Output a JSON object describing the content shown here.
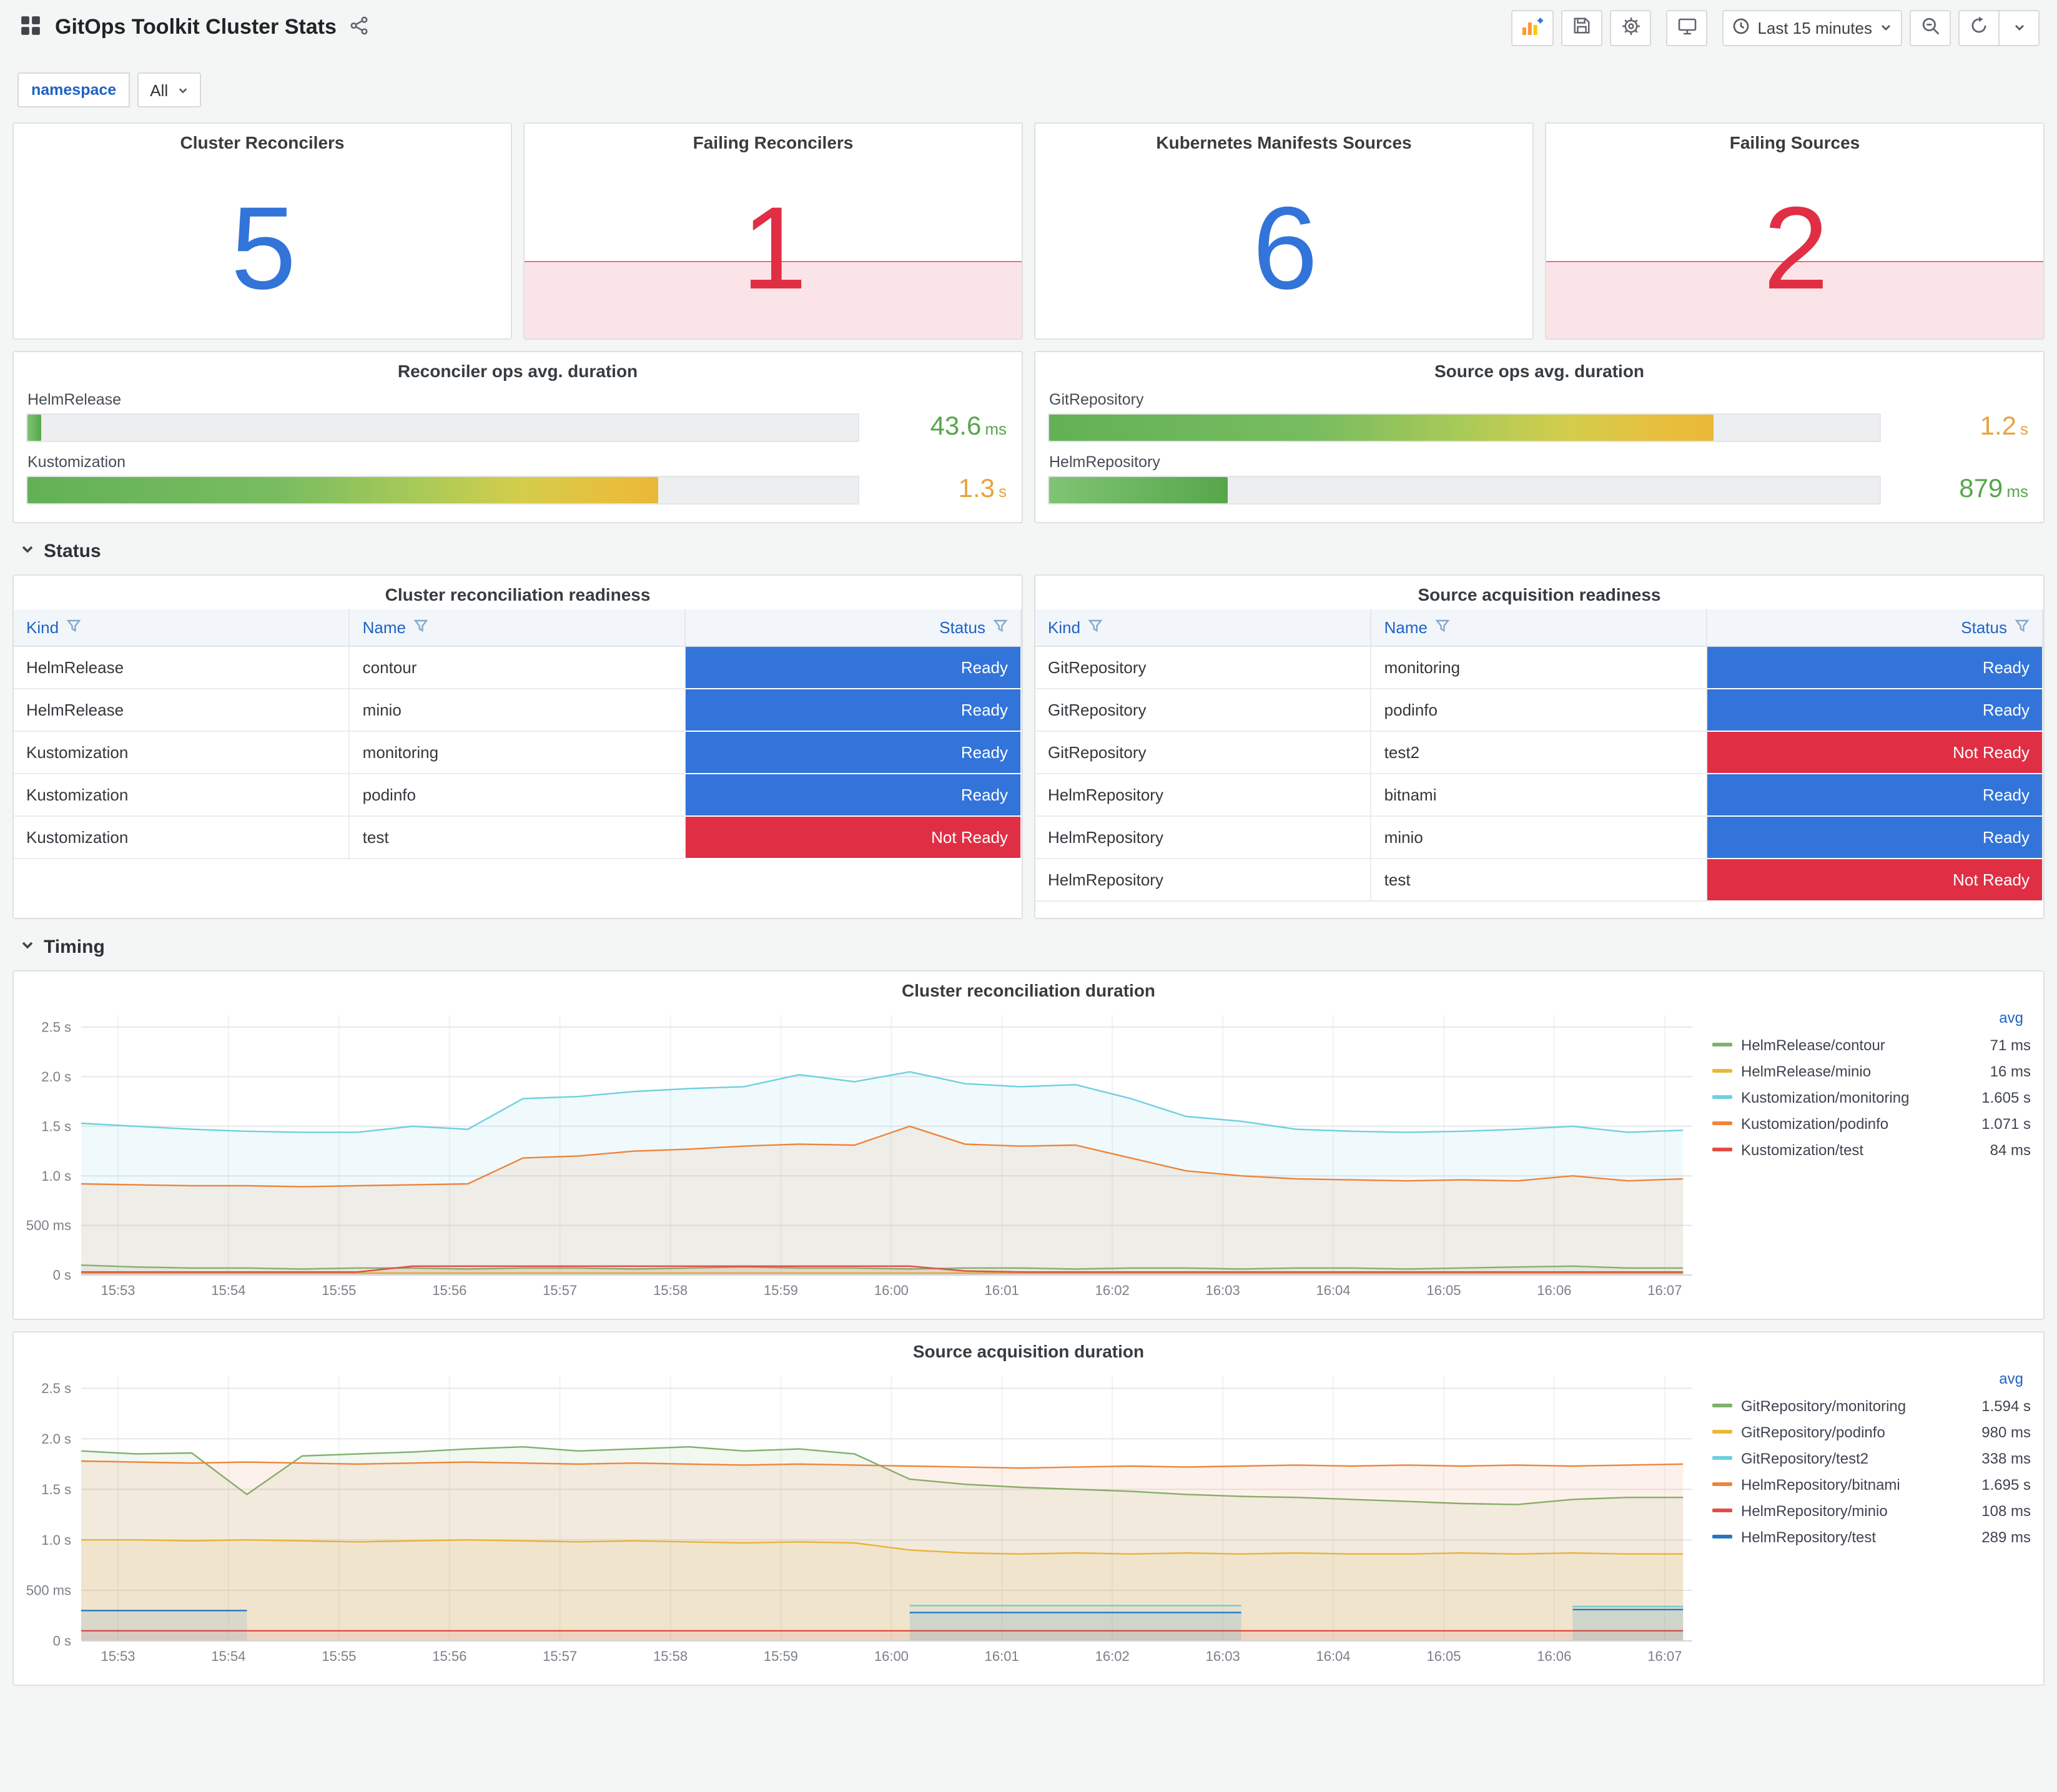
{
  "header": {
    "title": "GitOps Toolkit Cluster Stats",
    "time_range": "Last 15 minutes"
  },
  "icons": {
    "apps": "grid-icon",
    "share": "share-icon",
    "add_panel": "add-panel-icon",
    "save": "save-icon",
    "settings": "gear-icon",
    "tv": "monitor-icon",
    "clock": "clock-icon",
    "caret": "chevron-down-icon",
    "zoom_out": "zoom-out-icon",
    "refresh": "refresh-icon",
    "filter": "filter-funnel-icon"
  },
  "variables": {
    "label": "namespace",
    "value": "All"
  },
  "sections": {
    "status": "Status",
    "timing": "Timing"
  },
  "stats": [
    {
      "title": "Cluster Reconcilers",
      "value": "5",
      "color": "#3274d9",
      "fill": false
    },
    {
      "title": "Failing Reconcilers",
      "value": "1",
      "color": "#e02f44",
      "fill": true,
      "fill_bg": "rgba(224,47,68,0.13)",
      "fill_line": "rgba(224,47,68,0.65)"
    },
    {
      "title": "Kubernetes Manifests Sources",
      "value": "6",
      "color": "#3274d9",
      "fill": false
    },
    {
      "title": "Failing Sources",
      "value": "2",
      "color": "#e02f44",
      "fill": true,
      "fill_bg": "rgba(224,47,68,0.13)",
      "fill_line": "rgba(224,47,68,0.65)"
    }
  ],
  "gauges": [
    {
      "title": "Reconciler ops avg. duration",
      "rows": [
        {
          "label": "HelmRelease",
          "value": "43.6",
          "unit": "ms",
          "percent": 1.6,
          "value_color": "#56a64b",
          "gradient": "green"
        },
        {
          "label": "Kustomization",
          "value": "1.3",
          "unit": "s",
          "percent": 76,
          "value_color": "#e8a33c",
          "gradient": "green-yellow"
        }
      ]
    },
    {
      "title": "Source ops avg. duration",
      "rows": [
        {
          "label": "GitRepository",
          "value": "1.2",
          "unit": "s",
          "percent": 80,
          "value_color": "#e8a33c",
          "gradient": "green-yellow"
        },
        {
          "label": "HelmRepository",
          "value": "879",
          "unit": "ms",
          "percent": 21.5,
          "value_color": "#56a64b",
          "gradient": "green"
        }
      ]
    }
  ],
  "tables": [
    {
      "title": "Cluster reconciliation readiness",
      "columns": [
        "Kind",
        "Name",
        "Status"
      ],
      "rows": [
        {
          "kind": "HelmRelease",
          "name": "contour",
          "status": "Ready"
        },
        {
          "kind": "HelmRelease",
          "name": "minio",
          "status": "Ready"
        },
        {
          "kind": "Kustomization",
          "name": "monitoring",
          "status": "Ready"
        },
        {
          "kind": "Kustomization",
          "name": "podinfo",
          "status": "Ready"
        },
        {
          "kind": "Kustomization",
          "name": "test",
          "status": "Not Ready"
        }
      ]
    },
    {
      "title": "Source acquisition readiness",
      "columns": [
        "Kind",
        "Name",
        "Status"
      ],
      "rows": [
        {
          "kind": "GitRepository",
          "name": "monitoring",
          "status": "Ready"
        },
        {
          "kind": "GitRepository",
          "name": "podinfo",
          "status": "Ready"
        },
        {
          "kind": "GitRepository",
          "name": "test2",
          "status": "Not Ready"
        },
        {
          "kind": "HelmRepository",
          "name": "bitnami",
          "status": "Ready"
        },
        {
          "kind": "HelmRepository",
          "name": "minio",
          "status": "Ready"
        },
        {
          "kind": "HelmRepository",
          "name": "test",
          "status": "Not Ready"
        }
      ]
    }
  ],
  "status_colors": {
    "Ready": "#3274d9",
    "Not Ready": "#e02f44"
  },
  "chart_data": [
    {
      "type": "line",
      "title": "Cluster reconciliation duration",
      "xlabel": "",
      "ylabel": "",
      "grid": true,
      "legend_position": "right",
      "legend_header": "avg",
      "ylim": [
        0,
        2.62
      ],
      "yticks": [
        {
          "v": 0,
          "label": "0 s"
        },
        {
          "v": 0.5,
          "label": "500 ms"
        },
        {
          "v": 1,
          "label": "1.0 s"
        },
        {
          "v": 1.5,
          "label": "1.5 s"
        },
        {
          "v": 2,
          "label": "2.0 s"
        },
        {
          "v": 2.5,
          "label": "2.5 s"
        }
      ],
      "x0": 0,
      "x_step": 30,
      "x_range": [
        0,
        875
      ],
      "xticks": {
        "start": 20,
        "step": 60,
        "labels": [
          "15:53",
          "15:54",
          "15:55",
          "15:56",
          "15:57",
          "15:58",
          "15:59",
          "16:00",
          "16:01",
          "16:02",
          "16:03",
          "16:04",
          "16:05",
          "16:06",
          "16:07"
        ]
      },
      "series": [
        {
          "name": "HelmRelease/contour",
          "color": "#7EB26D",
          "avg": "71 ms",
          "values": [
            0.1,
            0.08,
            0.07,
            0.07,
            0.06,
            0.07,
            0.07,
            0.06,
            0.07,
            0.07,
            0.06,
            0.07,
            0.08,
            0.07,
            0.07,
            0.06,
            0.07,
            0.07,
            0.06,
            0.07,
            0.07,
            0.06,
            0.07,
            0.07,
            0.06,
            0.07,
            0.08,
            0.09,
            0.07,
            0.07
          ]
        },
        {
          "name": "HelmRelease/minio",
          "color": "#EAB839",
          "avg": "16 ms",
          "values": [
            0.02,
            0.02,
            0.02,
            0.02,
            0.02,
            0.02,
            0.02,
            0.02,
            0.02,
            0.02,
            0.02,
            0.02,
            0.02,
            0.02,
            0.02,
            0.02,
            0.02,
            0.02,
            0.02,
            0.02,
            0.02,
            0.02,
            0.02,
            0.02,
            0.02,
            0.02,
            0.02,
            0.02,
            0.02,
            0.02
          ]
        },
        {
          "name": "Kustomization/monitoring",
          "color": "#6ED0E0",
          "avg": "1.605 s",
          "values": [
            1.53,
            1.5,
            1.47,
            1.45,
            1.44,
            1.44,
            1.5,
            1.47,
            1.78,
            1.8,
            1.85,
            1.88,
            1.9,
            2.02,
            1.95,
            2.05,
            1.93,
            1.9,
            1.92,
            1.78,
            1.6,
            1.55,
            1.47,
            1.45,
            1.44,
            1.45,
            1.47,
            1.5,
            1.44,
            1.46
          ]
        },
        {
          "name": "Kustomization/podinfo",
          "color": "#EF843C",
          "avg": "1.071 s",
          "values": [
            0.92,
            0.91,
            0.9,
            0.9,
            0.89,
            0.9,
            0.91,
            0.92,
            1.18,
            1.2,
            1.25,
            1.27,
            1.3,
            1.32,
            1.31,
            1.5,
            1.32,
            1.3,
            1.31,
            1.18,
            1.05,
            1.0,
            0.97,
            0.96,
            0.95,
            0.96,
            0.95,
            1.0,
            0.95,
            0.97
          ]
        },
        {
          "name": "Kustomization/test",
          "color": "#E24D42",
          "avg": "84 ms",
          "values": [
            0.03,
            0.03,
            0.03,
            0.03,
            0.03,
            0.03,
            0.09,
            0.09,
            0.09,
            0.09,
            0.09,
            0.09,
            0.09,
            0.09,
            0.09,
            0.09,
            0.04,
            0.03,
            0.03,
            0.03,
            0.03,
            0.03,
            0.03,
            0.03,
            0.03,
            0.03,
            0.03,
            0.03,
            0.03,
            0.03
          ]
        }
      ]
    },
    {
      "type": "line",
      "title": "Source acquisition duration",
      "xlabel": "",
      "ylabel": "",
      "grid": true,
      "legend_position": "right",
      "legend_header": "avg",
      "ylim": [
        0,
        2.62
      ],
      "yticks": [
        {
          "v": 0,
          "label": "0 s"
        },
        {
          "v": 0.5,
          "label": "500 ms"
        },
        {
          "v": 1,
          "label": "1.0 s"
        },
        {
          "v": 1.5,
          "label": "1.5 s"
        },
        {
          "v": 2,
          "label": "2.0 s"
        },
        {
          "v": 2.5,
          "label": "2.5 s"
        }
      ],
      "x0": 0,
      "x_step": 30,
      "x_range": [
        0,
        875
      ],
      "xticks": {
        "start": 20,
        "step": 60,
        "labels": [
          "15:53",
          "15:54",
          "15:55",
          "15:56",
          "15:57",
          "15:58",
          "15:59",
          "16:00",
          "16:01",
          "16:02",
          "16:03",
          "16:04",
          "16:05",
          "16:06",
          "16:07"
        ]
      },
      "series": [
        {
          "name": "GitRepository/monitoring",
          "color": "#7EB26D",
          "avg": "1.594 s",
          "values": [
            1.88,
            1.85,
            1.86,
            1.45,
            1.83,
            1.85,
            1.87,
            1.9,
            1.92,
            1.88,
            1.9,
            1.92,
            1.88,
            1.9,
            1.85,
            1.6,
            1.55,
            1.52,
            1.5,
            1.48,
            1.45,
            1.43,
            1.42,
            1.4,
            1.38,
            1.36,
            1.35,
            1.4,
            1.42,
            1.42
          ]
        },
        {
          "name": "GitRepository/podinfo",
          "color": "#EAB839",
          "avg": "980 ms",
          "values": [
            1.0,
            1.0,
            0.99,
            1.0,
            0.99,
            0.98,
            0.99,
            1.0,
            0.99,
            0.98,
            0.99,
            0.98,
            0.97,
            0.98,
            0.97,
            0.9,
            0.87,
            0.86,
            0.87,
            0.86,
            0.87,
            0.86,
            0.87,
            0.86,
            0.86,
            0.87,
            0.86,
            0.87,
            0.86,
            0.86
          ]
        },
        {
          "name": "GitRepository/test2",
          "color": "#6ED0E0",
          "avg": "338 ms",
          "values": [
            null,
            null,
            null,
            null,
            null,
            null,
            null,
            null,
            null,
            null,
            null,
            null,
            null,
            null,
            null,
            0.35,
            0.35,
            0.35,
            0.35,
            0.35,
            0.35,
            0.35,
            null,
            null,
            null,
            null,
            null,
            0.34,
            0.34,
            0.34
          ]
        },
        {
          "name": "HelmRepository/bitnami",
          "color": "#EF843C",
          "avg": "1.695 s",
          "values": [
            1.78,
            1.77,
            1.76,
            1.77,
            1.76,
            1.75,
            1.76,
            1.77,
            1.76,
            1.75,
            1.76,
            1.75,
            1.74,
            1.75,
            1.74,
            1.73,
            1.72,
            1.71,
            1.72,
            1.73,
            1.72,
            1.73,
            1.74,
            1.73,
            1.74,
            1.73,
            1.74,
            1.73,
            1.74,
            1.75
          ]
        },
        {
          "name": "HelmRepository/minio",
          "color": "#E24D42",
          "avg": "108 ms",
          "values": [
            0.1,
            0.1,
            0.1,
            0.1,
            0.1,
            0.1,
            0.1,
            0.1,
            0.1,
            0.1,
            0.1,
            0.1,
            0.1,
            0.1,
            0.1,
            0.1,
            0.1,
            0.1,
            0.1,
            0.1,
            0.1,
            0.1,
            0.1,
            0.1,
            0.1,
            0.1,
            0.1,
            0.1,
            0.1,
            0.1
          ]
        },
        {
          "name": "HelmRepository/test",
          "color": "#1F78C1",
          "avg": "289 ms",
          "values": [
            0.3,
            0.3,
            0.3,
            0.3,
            null,
            null,
            null,
            null,
            null,
            null,
            null,
            null,
            null,
            null,
            null,
            0.28,
            0.28,
            0.28,
            0.28,
            0.28,
            0.28,
            0.28,
            null,
            null,
            null,
            null,
            null,
            0.31,
            0.31,
            0.31
          ]
        }
      ]
    }
  ]
}
